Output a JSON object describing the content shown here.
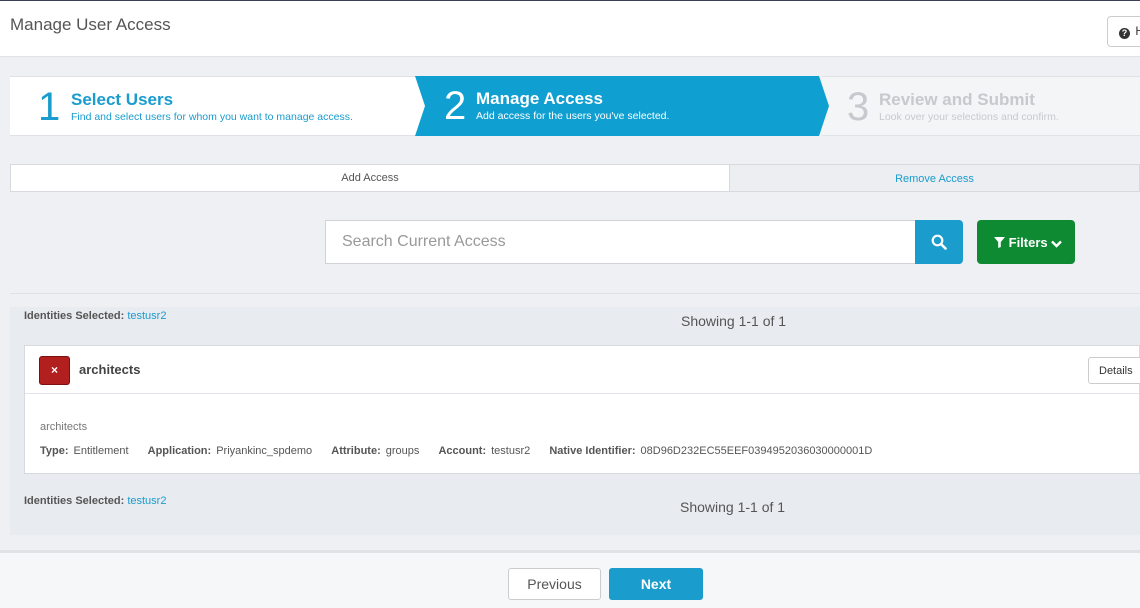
{
  "header": {
    "title": "Manage User Access",
    "help_label": "H"
  },
  "wizard": {
    "steps": [
      {
        "number": "1",
        "title": "Select Users",
        "description": "Find and select users for whom you want to manage access."
      },
      {
        "number": "2",
        "title": "Manage Access",
        "description": "Add access for the users you've selected."
      },
      {
        "number": "3",
        "title": "Review and Submit",
        "description": "Look over your selections and confirm."
      }
    ]
  },
  "tabs": {
    "add": "Add Access",
    "remove": "Remove Access"
  },
  "search": {
    "placeholder": "Search Current Access",
    "filters_label": "Filters"
  },
  "results": {
    "identities_label": "Identities Selected:",
    "identity": "testusr2",
    "showing": "Showing 1-1 of 1"
  },
  "item": {
    "remove_icon": "×",
    "title": "architects",
    "details_label": "Details",
    "description": "architects",
    "attributes": [
      {
        "key": "Type:",
        "value": "Entitlement"
      },
      {
        "key": "Application:",
        "value": "Priyankinc_spdemo"
      },
      {
        "key": "Attribute:",
        "value": "groups"
      },
      {
        "key": "Account:",
        "value": "testusr2"
      },
      {
        "key": "Native Identifier:",
        "value": "08D96D232EC55EEF0394952036030000001D"
      }
    ]
  },
  "footer": {
    "previous": "Previous",
    "next": "Next"
  },
  "colors": {
    "accent": "#1a9ccd",
    "filters": "#0d8a32",
    "remove": "#b21f1f"
  }
}
